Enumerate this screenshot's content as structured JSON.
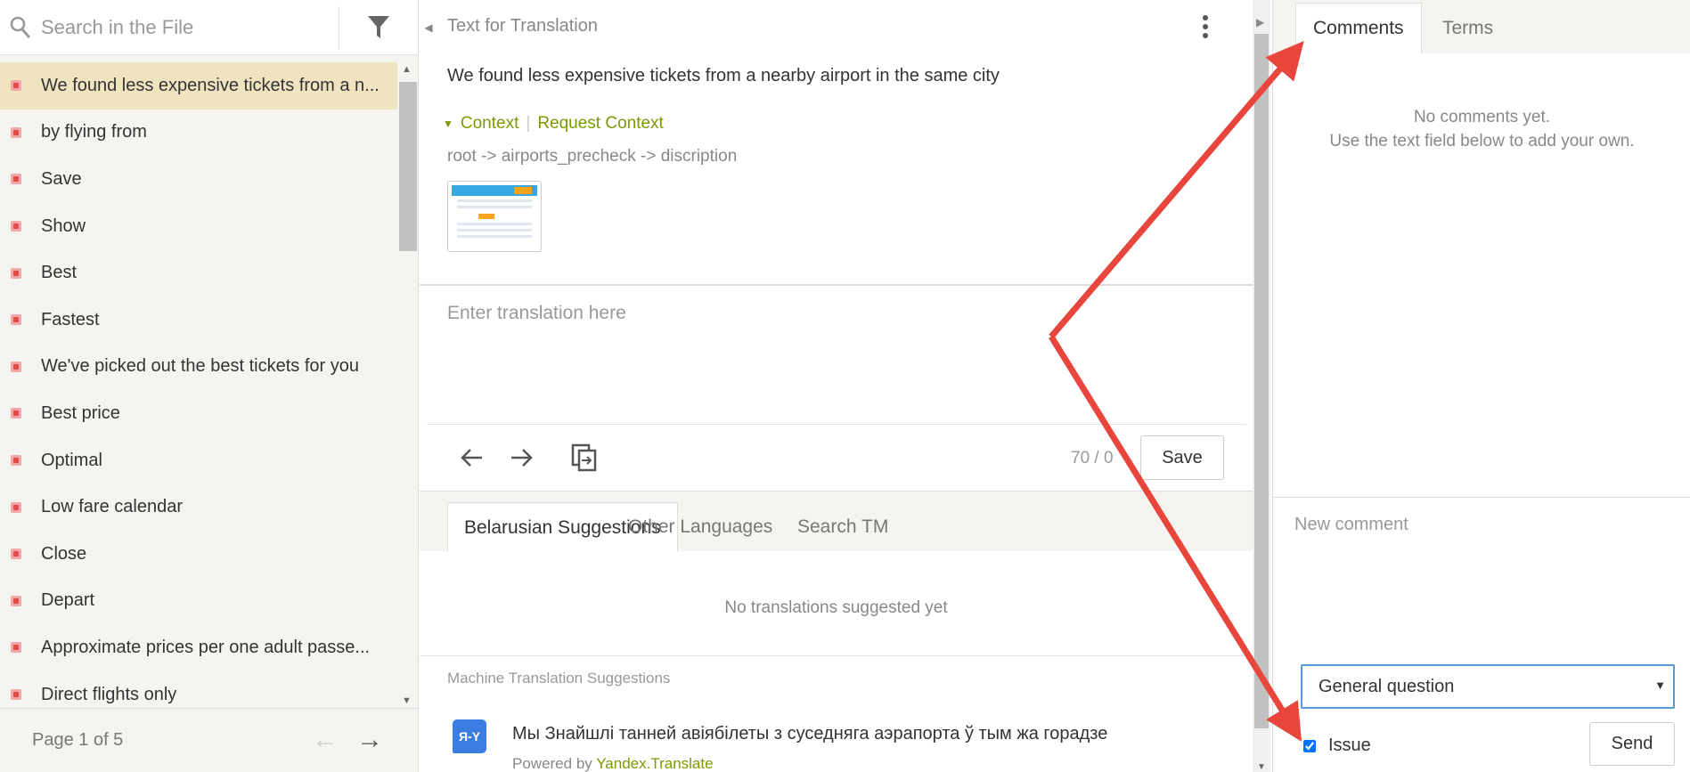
{
  "left": {
    "search_placeholder": "Search in the File",
    "items": [
      {
        "label": "We found less expensive tickets from a n...",
        "active": true
      },
      {
        "label": "by flying from"
      },
      {
        "label": "Save"
      },
      {
        "label": "Show"
      },
      {
        "label": "Best"
      },
      {
        "label": "Fastest"
      },
      {
        "label": "We've picked out the best tickets for you"
      },
      {
        "label": "Best price"
      },
      {
        "label": "Optimal"
      },
      {
        "label": "Low fare calendar"
      },
      {
        "label": "Close"
      },
      {
        "label": "Depart"
      },
      {
        "label": "Approximate prices per one adult passe..."
      },
      {
        "label": "Direct flights only"
      }
    ],
    "pager_text": "Page 1 of 5",
    "pager_prev": "←",
    "pager_next": "→"
  },
  "editor": {
    "title": "Text for Translation",
    "source_text": "We found less expensive tickets from a nearby airport in the same city",
    "context_label": "Context",
    "context_sep": "|",
    "request_context_label": "Request Context",
    "context_path": "root -> airports_precheck -> discription",
    "translation_placeholder": "Enter translation here",
    "char_count": "70 / 0",
    "save_label": "Save",
    "tabs": [
      {
        "label": "Belarusian Suggestions",
        "active": true
      },
      {
        "label": "Other Languages"
      },
      {
        "label": "Search TM"
      }
    ],
    "no_suggestions": "No translations suggested yet",
    "mt_label": "Machine Translation Suggestions",
    "mt_icon_text": "Я-Y",
    "mt_text": "Мы Знайшлі танней авіябілеты з суседняга аэрапорта ў тым жа горадзе",
    "mt_powered_prefix": "Powered by",
    "mt_powered_link": "Yandex.Translate"
  },
  "comments": {
    "tabs": [
      {
        "label": "Comments",
        "active": true
      },
      {
        "label": "Terms"
      }
    ],
    "empty_line1": "No comments yet.",
    "empty_line2": "Use the text field below to add your own.",
    "new_comment_placeholder": "New comment",
    "type_select": "General question",
    "issue_label": "Issue",
    "issue_checked": true,
    "send_label": "Send"
  },
  "colors": {
    "accent_green": "#7a9a00",
    "active_row": "#f0e4c0",
    "annotation_arrow": "#e8453c",
    "select_border": "#5b9bd5"
  }
}
